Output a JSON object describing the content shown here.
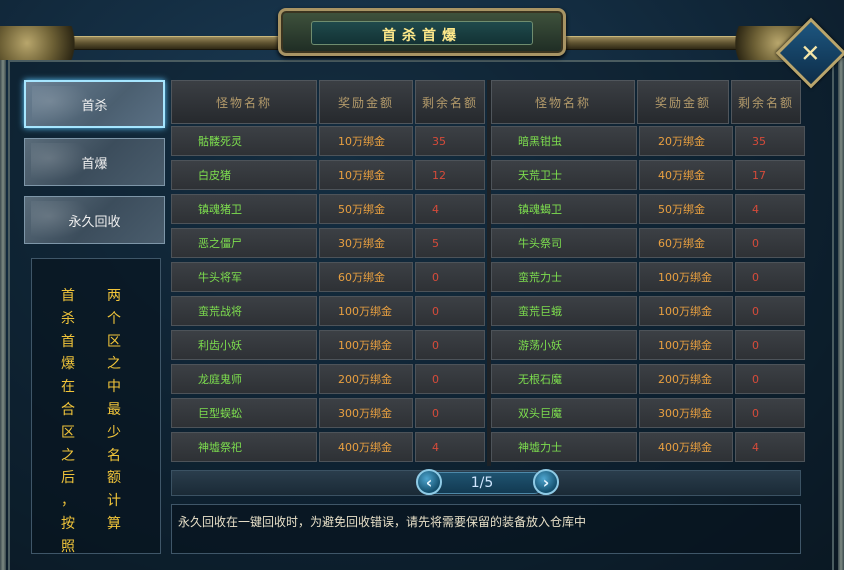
{
  "window": {
    "title": "首杀首爆",
    "close_icon": "crossed-swords-icon"
  },
  "tabs": [
    {
      "label": "首杀",
      "active": true
    },
    {
      "label": "首爆",
      "active": false
    },
    {
      "label": "永久回收",
      "active": false
    }
  ],
  "note": {
    "col1": [
      "首",
      "杀",
      "首",
      "爆",
      "在",
      "合",
      "区",
      "之",
      "后",
      "，",
      "按",
      "照"
    ],
    "col2": [
      "两",
      "个",
      "区",
      "之",
      "中",
      "最",
      "少",
      "名",
      "额",
      "计",
      "算"
    ]
  },
  "table": {
    "headers": [
      "怪物名称",
      "奖励金额",
      "剩余名额",
      "怪物名称",
      "奖励金额",
      "剩余名额"
    ],
    "left_rows": [
      {
        "name": "骷髅死灵",
        "reward": "10万绑金",
        "remaining": "35"
      },
      {
        "name": "白皮猪",
        "reward": "10万绑金",
        "remaining": "12"
      },
      {
        "name": "镇魂猪卫",
        "reward": "50万绑金",
        "remaining": "4"
      },
      {
        "name": "恶之僵尸",
        "reward": "30万绑金",
        "remaining": "5"
      },
      {
        "name": "牛头将军",
        "reward": "60万绑金",
        "remaining": "0"
      },
      {
        "name": "蛮荒战将",
        "reward": "100万绑金",
        "remaining": "0"
      },
      {
        "name": "利齿小妖",
        "reward": "100万绑金",
        "remaining": "0"
      },
      {
        "name": "龙庭鬼师",
        "reward": "200万绑金",
        "remaining": "0"
      },
      {
        "name": "巨型蜈蚣",
        "reward": "300万绑金",
        "remaining": "0"
      },
      {
        "name": "神墟祭祀",
        "reward": "400万绑金",
        "remaining": "4"
      }
    ],
    "right_rows": [
      {
        "name": "暗黑钳虫",
        "reward": "20万绑金",
        "remaining": "35"
      },
      {
        "name": "天荒卫士",
        "reward": "40万绑金",
        "remaining": "17"
      },
      {
        "name": "镇魂蝎卫",
        "reward": "50万绑金",
        "remaining": "4"
      },
      {
        "name": "牛头祭司",
        "reward": "60万绑金",
        "remaining": "0"
      },
      {
        "name": "蛮荒力士",
        "reward": "100万绑金",
        "remaining": "0"
      },
      {
        "name": "蛮荒巨蛾",
        "reward": "100万绑金",
        "remaining": "0"
      },
      {
        "name": "游荡小妖",
        "reward": "100万绑金",
        "remaining": "0"
      },
      {
        "name": "无根石魔",
        "reward": "200万绑金",
        "remaining": "0"
      },
      {
        "name": "双头巨魔",
        "reward": "300万绑金",
        "remaining": "0"
      },
      {
        "name": "神墟力士",
        "reward": "400万绑金",
        "remaining": "4"
      }
    ]
  },
  "pager": {
    "current": "1/5",
    "prev_icon": "chevron-left-icon",
    "next_icon": "chevron-right-icon"
  },
  "hint": "永久回收在一键回收时，为避免回收错误，请先将需要保留的装备放入仓库中",
  "colors": {
    "monster_name": "#7dde4e",
    "reward": "#e9a040",
    "remaining": "#d64b3a",
    "title": "#ffe98a",
    "note": "#f0c43a"
  }
}
